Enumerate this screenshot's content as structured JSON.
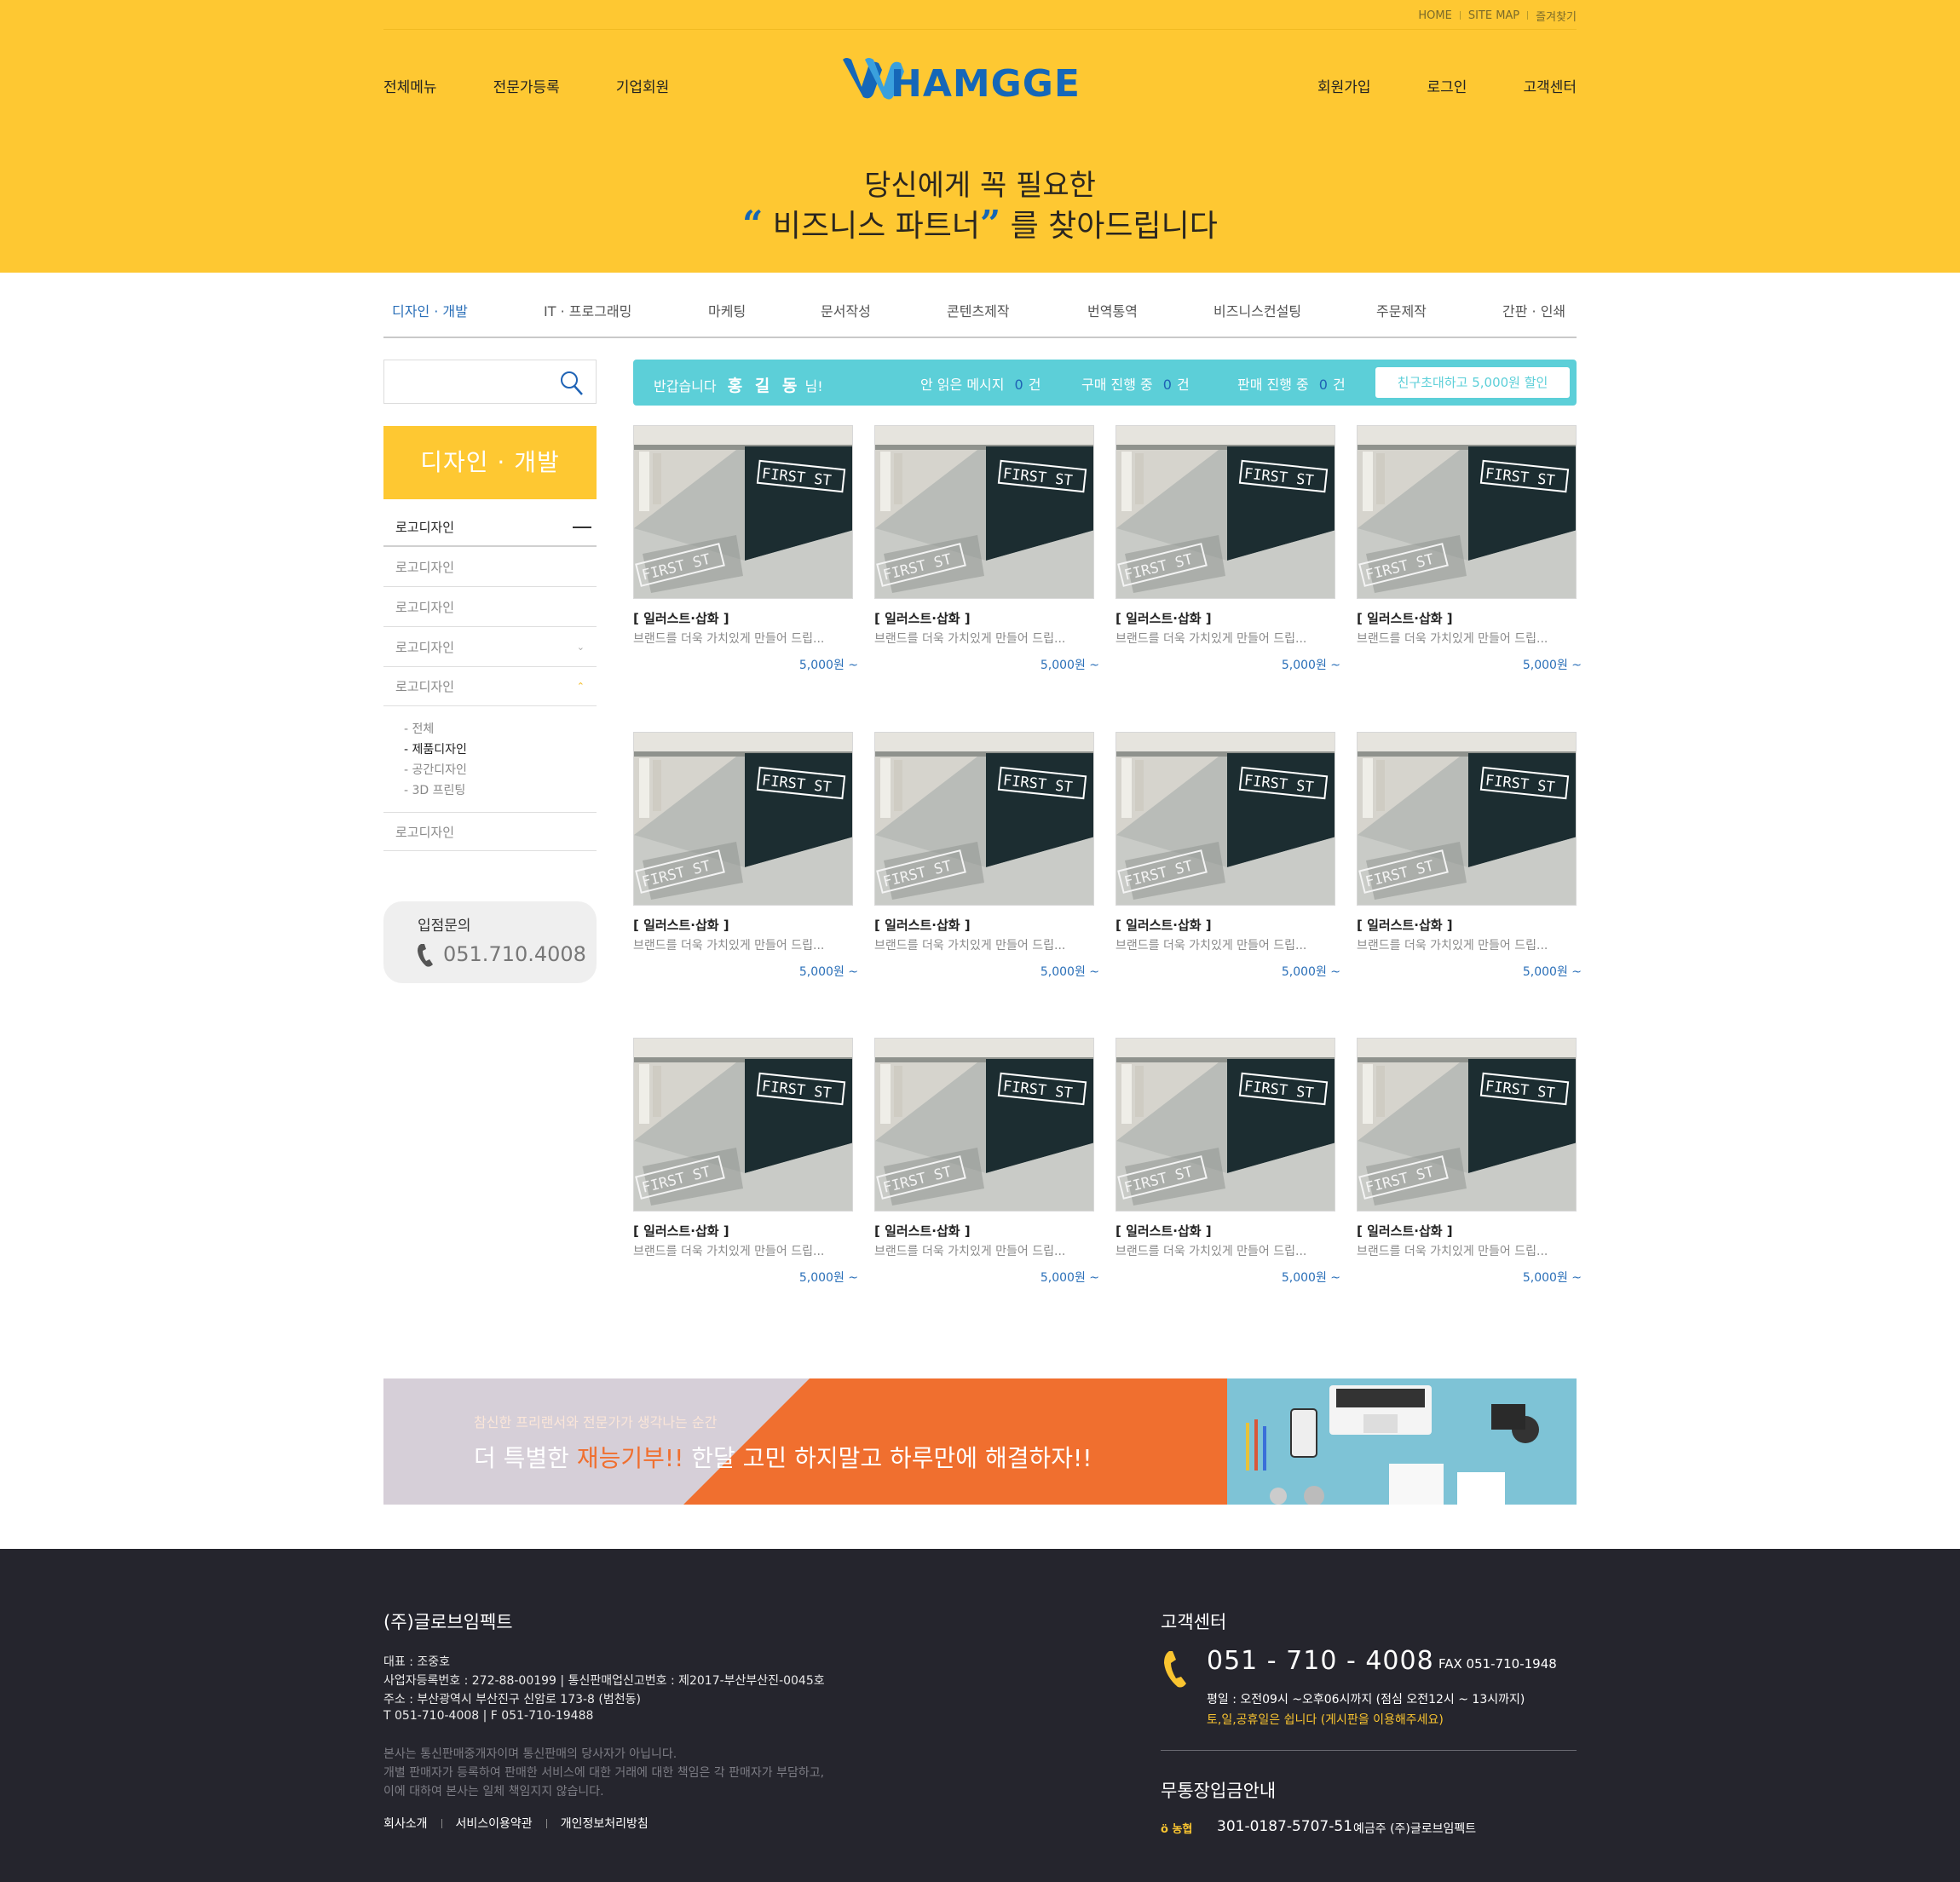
{
  "header": {
    "top_links": [
      "HOME",
      "SITE MAP",
      "즐겨찾기"
    ],
    "nav_left": [
      "전체메뉴",
      "전문가등록",
      "기업회원"
    ],
    "logo_text": "HAMGGE",
    "nav_right": [
      "회원가입",
      "로그인",
      "고객센터"
    ],
    "hero_line1": "당신에게 꼭 필요한",
    "hero_quote_open": "“",
    "hero_highlight": " 비즈니스 파트너",
    "hero_quote_close": "”",
    "hero_tail": " 를 찾아드립니다"
  },
  "category_nav": [
    "디자인 · 개발",
    "IT · 프로그래밍",
    "마케팅",
    "문서작성",
    "콘텐츠제작",
    "번역통역",
    "비즈니스컨설팅",
    "주문제작",
    "간판 · 인쇄"
  ],
  "sidebar": {
    "search_placeholder": "",
    "title": "디자인 · 개발",
    "items": [
      "로고디자인",
      "로고디자인",
      "로고디자인",
      "로고디자인",
      "로고디자인",
      "로고디자인"
    ],
    "subitems": [
      "- 전체",
      "- 제품디자인",
      "- 공간디자인",
      "- 3D 프린팅"
    ],
    "inquiry_title": "입점문의",
    "inquiry_phone": "051.710.4008"
  },
  "welcome": {
    "greeting": "반갑습니다",
    "user": "홍 길 동",
    "suffix": "님!",
    "unread_label": "안 읽은 메시지",
    "unread_count": "0",
    "buy_label": "구매 진행 중",
    "buy_count": "0",
    "sell_label": "판매 진행 중",
    "sell_count": "0",
    "unit": "건",
    "invite_button": "친구초대하고 5,000원 할인"
  },
  "products": [
    {
      "category": "[ 일러스트·삽화 ]",
      "desc": "브랜드를 더욱 가치있게 만들어 드립...",
      "price": "5,000원 ~"
    },
    {
      "category": "[ 일러스트·삽화 ]",
      "desc": "브랜드를 더욱 가치있게 만들어 드립...",
      "price": "5,000원 ~"
    },
    {
      "category": "[ 일러스트·삽화 ]",
      "desc": "브랜드를 더욱 가치있게 만들어 드립...",
      "price": "5,000원 ~"
    },
    {
      "category": "[ 일러스트·삽화 ]",
      "desc": "브랜드를 더욱 가치있게 만들어 드립...",
      "price": "5,000원 ~"
    },
    {
      "category": "[ 일러스트·삽화 ]",
      "desc": "브랜드를 더욱 가치있게 만들어 드립...",
      "price": "5,000원 ~"
    },
    {
      "category": "[ 일러스트·삽화 ]",
      "desc": "브랜드를 더욱 가치있게 만들어 드립...",
      "price": "5,000원 ~"
    },
    {
      "category": "[ 일러스트·삽화 ]",
      "desc": "브랜드를 더욱 가치있게 만들어 드립...",
      "price": "5,000원 ~"
    },
    {
      "category": "[ 일러스트·삽화 ]",
      "desc": "브랜드를 더욱 가치있게 만들어 드립...",
      "price": "5,000원 ~"
    },
    {
      "category": "[ 일러스트·삽화 ]",
      "desc": "브랜드를 더욱 가치있게 만들어 드립...",
      "price": "5,000원 ~"
    },
    {
      "category": "[ 일러스트·삽화 ]",
      "desc": "브랜드를 더욱 가치있게 만들어 드립...",
      "price": "5,000원 ~"
    },
    {
      "category": "[ 일러스트·삽화 ]",
      "desc": "브랜드를 더욱 가치있게 만들어 드립...",
      "price": "5,000원 ~"
    },
    {
      "category": "[ 일러스트·삽화 ]",
      "desc": "브랜드를 더욱 가치있게 만들어 드립...",
      "price": "5,000원 ~"
    }
  ],
  "banner": {
    "subtitle": "참신한 프리랜서와 전문가가 생각나는 순간",
    "title_pre": "더 특별한 ",
    "title_highlight": "재능기부!!",
    "title_post": " 한달 고민 하지말고 하루만에 해결하자!!"
  },
  "footer": {
    "company": "(주)글로브임펙트",
    "info_lines": [
      "대표 : 조중호",
      "사업자등록번호 : 272-88-00199    |    통신판매업신고번호 : 제2017-부산부산진-0045호",
      "주소 : 부산광역시 부산진구 신암로 173-8 (범천동)",
      "T 051-710-4008    |    F 051-710-19488"
    ],
    "disclaimer": [
      "본사는 통신판매중개자이며 통신판매의 당사자가 아닙니다.",
      "개별 판매자가 등록하여 판매한 서비스에 대한 거래에 대한 책임은 각 판매자가 부담하고,",
      "이에 대하여 본사는 일체 책임지지 않습니다."
    ],
    "links": [
      "회사소개",
      "서비스이용약관",
      "개인정보처리방침"
    ],
    "cs_title": "고객센터",
    "cs_phone": "051 - 710 - 4008",
    "cs_fax": "FAX 051-710-1948",
    "cs_hours": "평일 : 오전09시 ~오후06시까지 (점심 오전12시 ~ 13시까지)",
    "cs_holiday": "토,일,공휴일은 쉽니다 (게시판을 이용해주세요)",
    "bank_title": "무통장입금안내",
    "bank_name": "농협",
    "bank_account": "301-0187-5707-51",
    "bank_holder": "예금주 (주)글로브임펙트"
  },
  "colors": {
    "brand_yellow": "#fec832",
    "brand_blue": "#1567b8",
    "welcome_cyan": "#5ccfd8",
    "banner_orange": "#f06f2f",
    "footer_dark": "#25252d"
  }
}
